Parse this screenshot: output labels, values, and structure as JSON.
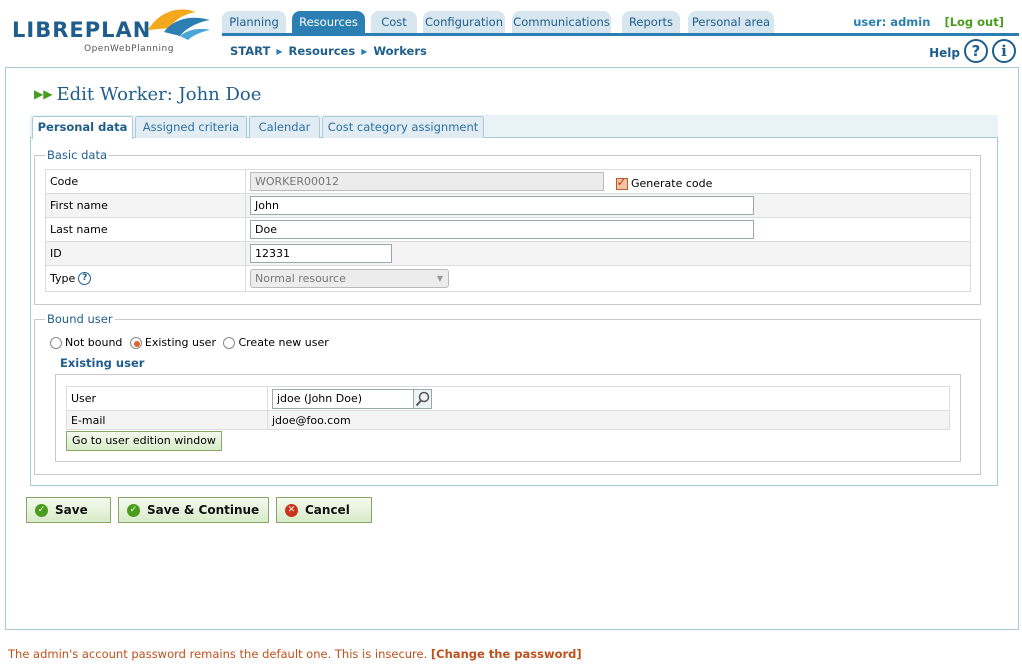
{
  "app": {
    "logo_word": "LIBREPLAN",
    "logo_tagline": "OpenWebPlanning"
  },
  "topnav": {
    "tabs": [
      {
        "label": "Planning",
        "active": false
      },
      {
        "label": "Resources",
        "active": true
      },
      {
        "label": "Cost",
        "active": false
      },
      {
        "label": "Configuration",
        "active": false
      },
      {
        "label": "Communications",
        "active": false
      },
      {
        "label": "Reports",
        "active": false
      },
      {
        "label": "Personal area",
        "active": false
      }
    ],
    "user_label": "user: admin",
    "logout_label": "[Log out]"
  },
  "breadcrumb": [
    "START",
    "Resources",
    "Workers"
  ],
  "help": {
    "label": "Help",
    "help_icon": "question-circle-icon",
    "info_icon": "info-circle-icon"
  },
  "page": {
    "title": "Edit Worker: John Doe"
  },
  "tabs": [
    {
      "label": "Personal data",
      "active": true
    },
    {
      "label": "Assigned criteria",
      "active": false
    },
    {
      "label": "Calendar",
      "active": false
    },
    {
      "label": "Cost category assignment",
      "active": false
    }
  ],
  "basic_data": {
    "legend": "Basic data",
    "code_label": "Code",
    "code_value": "WORKER00012",
    "generate_code_label": "Generate code",
    "generate_code_checked": true,
    "first_name_label": "First name",
    "first_name_value": "John",
    "last_name_label": "Last name",
    "last_name_value": "Doe",
    "id_label": "ID",
    "id_value": "12331",
    "type_label": "Type",
    "type_value": "Normal resource"
  },
  "bound_user": {
    "legend": "Bound user",
    "options": [
      {
        "label": "Not bound",
        "selected": false
      },
      {
        "label": "Existing user",
        "selected": true
      },
      {
        "label": "Create new user",
        "selected": false
      }
    ],
    "existing_title": "Existing user",
    "user_label": "User",
    "user_value": "jdoe (John Doe)",
    "email_label": "E-mail",
    "email_value": "jdoe@foo.com",
    "go_button": "Go to user edition window"
  },
  "actions": {
    "save": "Save",
    "save_continue": "Save & Continue",
    "cancel": "Cancel"
  },
  "footer": {
    "message": "The admin's account password remains the default one. This is insecure.",
    "link": "[Change the password]"
  },
  "colors": {
    "brand": "#1f5e8c",
    "accent": "#2b7fb2",
    "ok": "#4a9c1f",
    "warn": "#c0501a"
  }
}
